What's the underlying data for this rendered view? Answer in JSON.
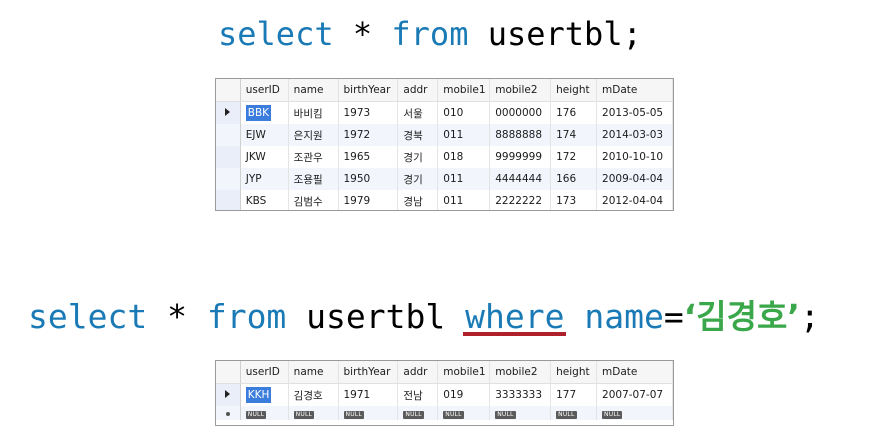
{
  "query1": {
    "kw1": "select",
    "mid1": " * ",
    "kw2": "from",
    "tail": " usertbl;"
  },
  "query2": {
    "kw1": "select",
    "mid1": " * ",
    "kw2": "from",
    "mid2": " usertbl ",
    "kw3": "where",
    "col": " name",
    "eq": "=",
    "str": "‘김경호’",
    "end": ";"
  },
  "grid1": {
    "columns": [
      "userID",
      "name",
      "birthYear",
      "addr",
      "mobile1",
      "mobile2",
      "height",
      "mDate"
    ],
    "rows": [
      [
        "BBK",
        "바비킴",
        "1973",
        "서울",
        "010",
        "0000000",
        "176",
        "2013-05-05"
      ],
      [
        "EJW",
        "은지원",
        "1972",
        "경북",
        "011",
        "8888888",
        "174",
        "2014-03-03"
      ],
      [
        "JKW",
        "조관우",
        "1965",
        "경기",
        "018",
        "9999999",
        "172",
        "2010-10-10"
      ],
      [
        "JYP",
        "조용필",
        "1950",
        "경기",
        "011",
        "4444444",
        "166",
        "2009-04-04"
      ],
      [
        "KBS",
        "김범수",
        "1979",
        "경남",
        "011",
        "2222222",
        "173",
        "2012-04-04"
      ]
    ]
  },
  "grid2": {
    "columns": [
      "userID",
      "name",
      "birthYear",
      "addr",
      "mobile1",
      "mobile2",
      "height",
      "mDate"
    ],
    "rows": [
      [
        "KKH",
        "김경호",
        "1971",
        "전남",
        "019",
        "3333333",
        "177",
        "2007-07-07"
      ]
    ],
    "null_label": "NULL"
  },
  "colors": {
    "keyword": "#1a7ab6",
    "string": "#3aa84a",
    "underline": "#b0202a",
    "selection": "#3b7ddd"
  }
}
